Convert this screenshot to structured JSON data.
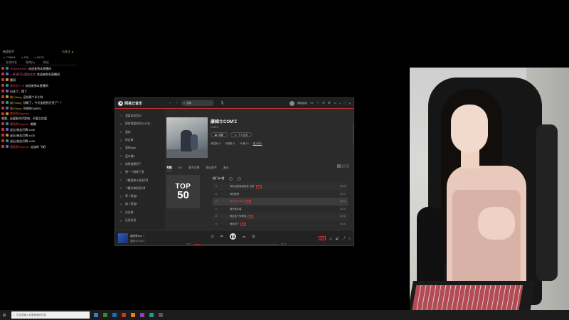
{
  "chat": {
    "header_left": "抽奖助手",
    "header_right": "已关注",
    "stats": [
      "776661",
      "765",
      "90/79"
    ],
    "tabs": [
      "在线排名",
      "贵宾(0)",
      "粉丝"
    ],
    "messages": [
      {
        "badge": "",
        "nick": "XXXXXXXXX",
        "text": "欢迎来到本直播间",
        "nick_color": "pink"
      },
      {
        "badge": "",
        "nick": "一杯清可乐要加冰块",
        "text": "欢迎来到本直播间",
        "nick_color": "pink"
      },
      {
        "badge": "",
        "nick": "",
        "text": "播间",
        "nick_color": ""
      },
      {
        "badge": "",
        "nick": "我的恋人·♥",
        "text": "欢迎来到本直播间",
        "nick_color": "red"
      },
      {
        "badge": "",
        "nick": "",
        "text": "幻化了，饿了",
        "nick_color": ""
      },
      {
        "badge": "",
        "nick": "路小liang",
        "text": "还有两个半小时",
        "nick_color": "gold"
      },
      {
        "badge": "",
        "nick": "路小liang",
        "text": "别睡了，今天加班到天亮了？？",
        "nick_color": "gold"
      },
      {
        "badge": "",
        "nick": "路小liang",
        "text": "你把你GWEEL",
        "nick_color": "gold"
      },
      {
        "badge": "",
        "nick": "懂雨家Rayman",
        "text": "哦哦，还要赶时代是吧，不要太欣喜",
        "nick_color": "red"
      },
      {
        "badge": "",
        "nick": "懂雨家Rayman",
        "text": "哦哦",
        "nick_color": "red"
      },
      {
        "badge": "",
        "nick": "",
        "text": "送出 粉丝灯牌 x100",
        "nick_color": ""
      },
      {
        "badge": "",
        "nick": "",
        "text": "送出 粉丝灯牌 x100",
        "nick_color": ""
      },
      {
        "badge": "",
        "nick": "",
        "text": "送出 粉丝灯牌 x100",
        "nick_color": ""
      },
      {
        "badge": "",
        "nick": "懂雨家Rayman",
        "text": "加油吗 飞吧",
        "nick_color": "red"
      }
    ]
  },
  "player": {
    "app_name": "网易云音乐",
    "search_placeholder": "搜索",
    "user_name": "偏执曲目",
    "vip_label": "VIP",
    "sidebar": [
      "我喜欢的音乐",
      "那些我喜欢的2019年...",
      "我的",
      "听过歌",
      "我的bgm",
      "蓝鸟唱K",
      "如果我想哭了",
      "想一个唯美了很",
      "【暖意和沙发系列】",
      "【暖冬和家系列】",
      "等《烈焰》",
      "城《烈焰》",
      "古风歌",
      "日语系列"
    ],
    "artist": {
      "name": "康姆士COM'Z",
      "sub": "COM'Z",
      "collect_label": "收藏",
      "homepage_label": "个人主页",
      "stats": [
        "单曲数:15",
        "专辑数:11",
        "MV数:19"
      ],
      "profile_link": "进入简介"
    },
    "tabs": [
      "专辑",
      "MV",
      "歌手详情",
      "相似歌手",
      "演出"
    ],
    "cover_text_top": "TOP",
    "cover_text_num": "50",
    "hot_title": "热门50首",
    "songs": [
      {
        "idx": "01",
        "title": "你永远是我最初的, 也好",
        "tag": "SQ",
        "dur": "05:28",
        "playing": false
      },
      {
        "idx": "02",
        "title": "你的爱恨",
        "tag": "",
        "dur": "04:49",
        "playing": false
      },
      {
        "idx": "03",
        "title": "等你爱COM'Z",
        "tag": "SQ",
        "dur": "05:41",
        "playing": true
      },
      {
        "idx": "04",
        "title": "撕开那片城",
        "tag": "",
        "dur": "04:30",
        "playing": false
      },
      {
        "idx": "05",
        "title": "就应该了你等待",
        "tag": "SQ",
        "dur": "04:58",
        "playing": false
      },
      {
        "idx": "06",
        "title": "我说说了",
        "tag": "SQ",
        "dur": "04:18",
        "playing": false
      }
    ],
    "now_playing": {
      "title": "我的思Vox",
      "artist": "康姆士COM'Z",
      "time_current": "00:21",
      "time_total": "05:41",
      "progress": 0.08
    },
    "hq_label": "极高"
  },
  "taskbar": {
    "search_placeholder": "在这里输入你要搜索的内容"
  }
}
